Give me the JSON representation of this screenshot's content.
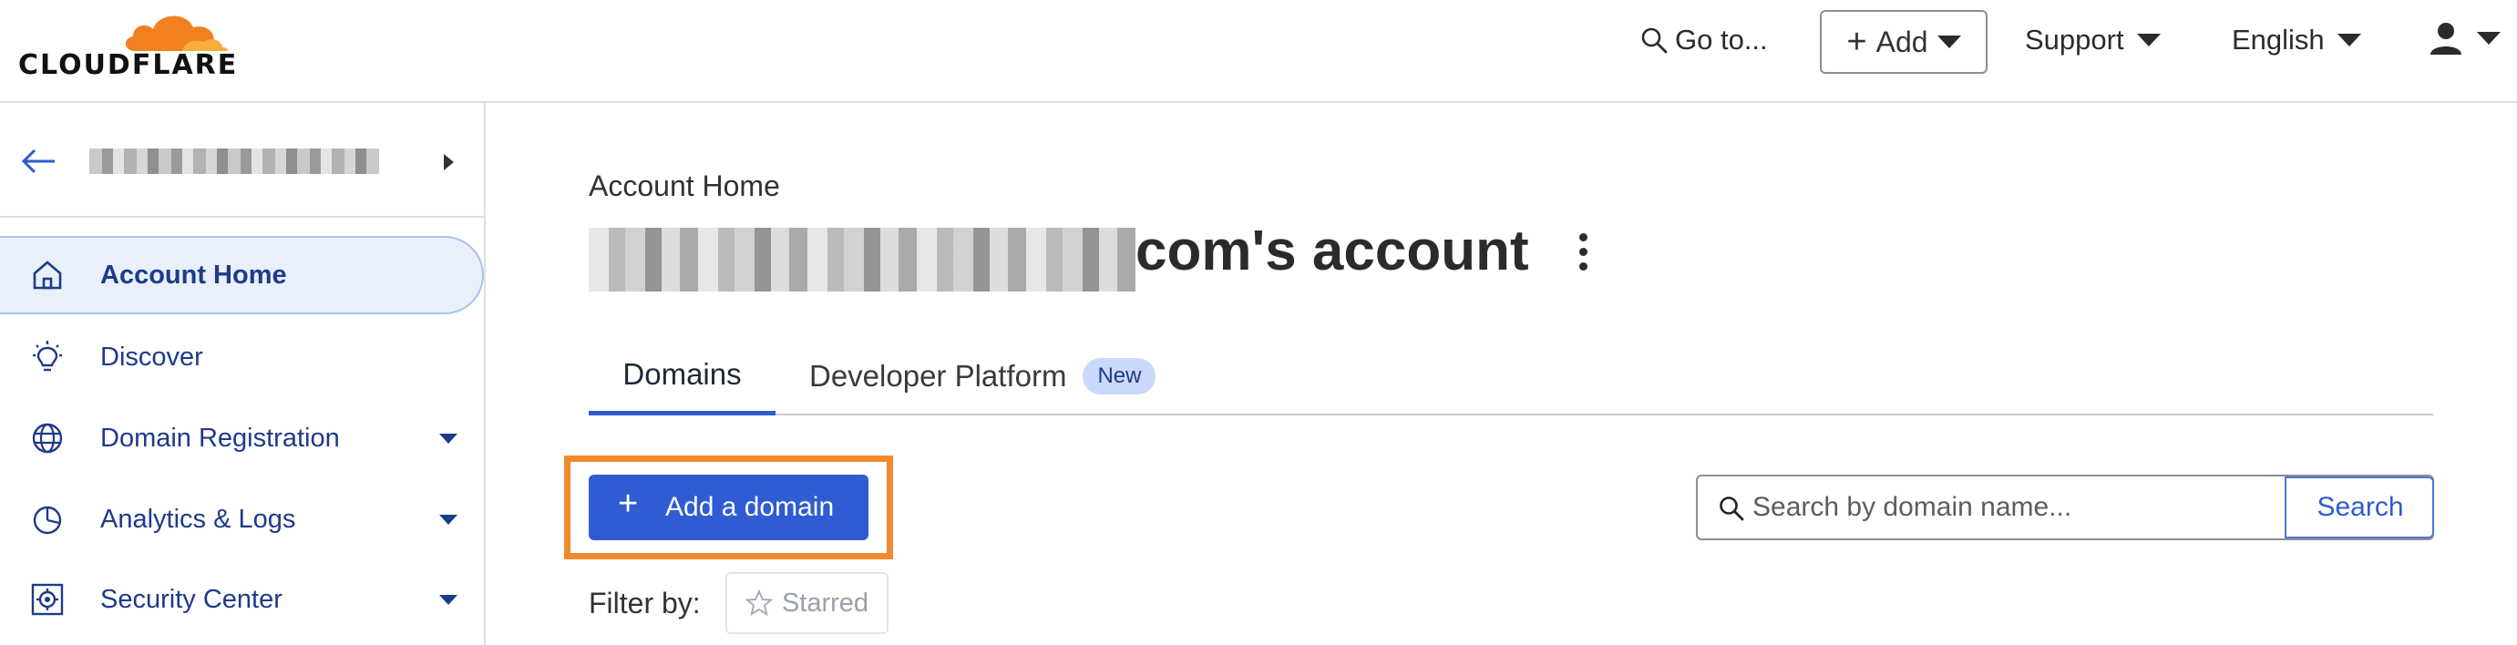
{
  "header": {
    "brand": "CLOUDFLARE",
    "goto_label": "Go to...",
    "add_label": "Add",
    "support_label": "Support",
    "language_label": "English"
  },
  "sidebar": {
    "items": [
      {
        "label": "Account Home",
        "icon": "home-icon",
        "active": true
      },
      {
        "label": "Discover",
        "icon": "lightbulb-icon"
      },
      {
        "label": "Domain Registration",
        "icon": "globe-icon",
        "expandable": true
      },
      {
        "label": "Analytics & Logs",
        "icon": "pie-chart-icon",
        "expandable": true
      },
      {
        "label": "Security Center",
        "icon": "shield-gear-icon",
        "expandable": true
      }
    ]
  },
  "main": {
    "breadcrumb": "Account Home",
    "title_suffix": "com's account",
    "tabs": [
      {
        "label": "Domains",
        "active": true
      },
      {
        "label": "Developer Platform",
        "badge": "New"
      }
    ],
    "add_domain_label": "Add a domain",
    "search": {
      "placeholder": "Search by domain name...",
      "button_label": "Search"
    },
    "filter_label": "Filter by:",
    "starred_label": "Starred"
  },
  "colors": {
    "accent": "#2f5bd3",
    "highlight": "#f08a2c",
    "nav_text": "#1e3a8a",
    "cloud_orange": "#f38020"
  }
}
